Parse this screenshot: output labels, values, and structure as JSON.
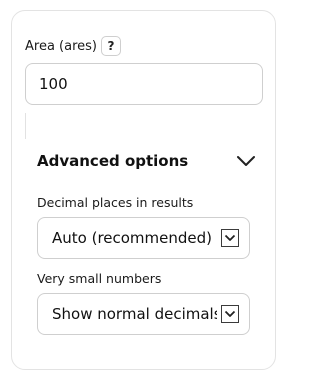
{
  "area_field": {
    "label": "Area (ares)",
    "help_label": "?",
    "value": "100"
  },
  "advanced": {
    "title": "Advanced options",
    "expanded": true,
    "decimal_places": {
      "label": "Decimal places in results",
      "selected": "Auto (recommended)"
    },
    "small_numbers": {
      "label": "Very small numbers",
      "selected": "Show normal decimals"
    }
  },
  "icons": {
    "help": "question-mark-icon",
    "expand": "chevron-down-icon",
    "dropdown": "dropdown-arrow-icon"
  }
}
